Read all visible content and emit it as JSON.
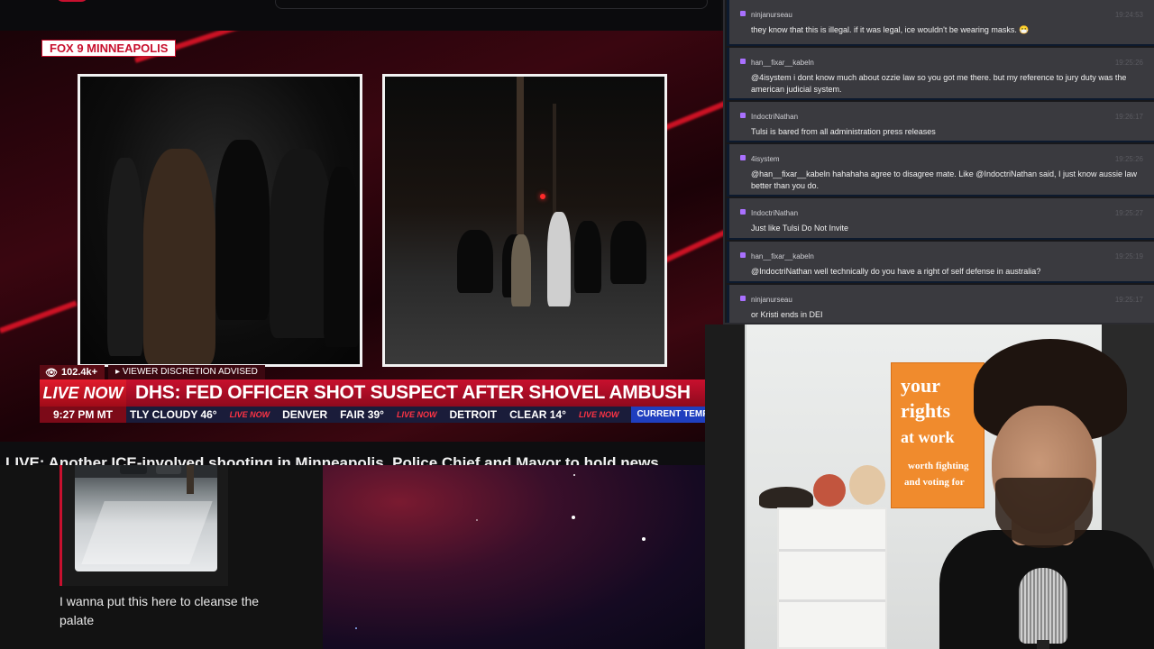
{
  "news": {
    "station": "FOX 9 MINNEAPOLIS",
    "viewer_count": "102.4k+",
    "discretion": "VIEWER DISCRETION ADVISED",
    "live_badge": "LIVE NOW",
    "headline": "DHS: FED OFFICER SHOT SUSPECT AFTER SHOVEL AMBUSH",
    "time": "9:27 PM MT",
    "ticker": [
      {
        "text": "TLY CLOUDY 46°"
      },
      {
        "badge": "LIVE NOW"
      },
      {
        "text": "DENVER"
      },
      {
        "text": "FAIR 39°"
      },
      {
        "badge": "LIVE NOW"
      },
      {
        "text": "DETROIT"
      },
      {
        "text": "CLEAR 14°"
      },
      {
        "badge": "LIVE NOW"
      },
      {
        "current": "CURRENT TEMPS"
      }
    ]
  },
  "stream_title": "LIVE: Another ICE-involved shooting in Minneapolis, Police Chief and Mayor to hold news",
  "clip": {
    "caption": "I wanna put this here to cleanse the palate"
  },
  "chat": {
    "messages": [
      {
        "user": "ninjanurseau",
        "time": "19:24:53",
        "text": "they know that this is illegal. if it was legal, ice wouldn't be wearing masks. 😷"
      },
      {
        "user": "han__fixar__kabeln",
        "time": "19:25:26",
        "text": "@4isystem i dont know much about ozzie law so you got me there. but my reference to jury duty was the american judicial system."
      },
      {
        "user": "IndoctriNathan",
        "time": "19:26:17",
        "text": "Tulsi is bared from all administration press releases"
      },
      {
        "user": "4isystem",
        "time": "19:25:26",
        "text": "@han__fixar__kabeln hahahaha agree to disagree mate. Like @IndoctriNathan said, I just know aussie law better than you do."
      },
      {
        "user": "IndoctriNathan",
        "time": "19:25:27",
        "text": "Just like Tulsi Do Not Invite"
      },
      {
        "user": "han__fixar__kabeln",
        "time": "19:25:19",
        "text": "@IndoctriNathan well technically do you have a right of self defense in australia?"
      },
      {
        "user": "ninjanurseau",
        "time": "19:25:17",
        "text": "or Kristi ends in DEI"
      }
    ]
  },
  "webcam": {
    "poster_lines": [
      "your",
      "rights",
      "at work",
      "worth fighting",
      "and voting for"
    ]
  },
  "colors": {
    "accent_red": "#c8102e",
    "chat_bg": "#18181b",
    "ticker_bg": "#1a1c3a"
  }
}
